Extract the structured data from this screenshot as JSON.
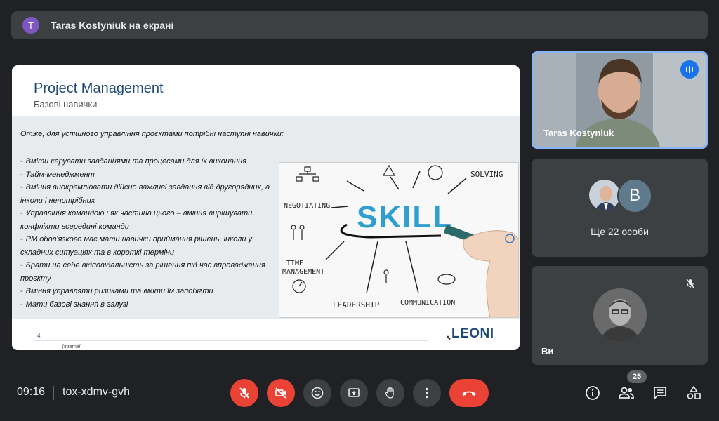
{
  "banner": {
    "avatar_letter": "T",
    "title": "Taras Kostyniuk на екрані"
  },
  "slide": {
    "title": "Project Management",
    "subtitle": "Базові навички",
    "intro": "Отже, для успішного управління проєктами потрібні наступні навички:",
    "bullets": [
      "Вміти керувати завданнями та процесами для їх виконання",
      "Тайм-менеджмент",
      "Вміння виокремлювати дійсно важливі завдання від другорядних, а інколи і непотрібних",
      "Управління командою і як частина цього – вміння вирішувати конфлікти всередині команди",
      "PM обов'язково має мати навички приймання рішень, інколи у складних ситуаціях та в короткі терміни",
      "Брати на себе відповідальність за рішення під час впровадження проєкту",
      "Вміння управляти ризиками та вміти їм запобігти",
      "Мати базові знання в галузі"
    ],
    "image_words": {
      "skill": "SKILL",
      "negotiating": "NEGOTIATING",
      "solving": "SOLVING",
      "time": "TIME",
      "management": "MANAGEMENT",
      "leadership": "LEADERSHIP",
      "communication": "COMMUNICATION"
    },
    "page_number": "4",
    "classification": "[Internal]",
    "logo": "LEONI"
  },
  "tiles": {
    "presenter_name": "Taras Kostyniuk",
    "more_avatar_letter": "B",
    "more_label": "Ще 22 особи",
    "self_label": "Ви"
  },
  "bottom": {
    "time": "09:16",
    "meeting_code": "tox-xdmv-gvh",
    "participants_count": "25"
  },
  "colors": {
    "background": "#202124",
    "surface": "#3c4043",
    "danger": "#ea4335",
    "accent": "#8ab4f8",
    "slide_title": "#1e4a7a"
  },
  "icons": [
    "mic-off-icon",
    "camera-off-icon",
    "emoji-icon",
    "present-icon",
    "hand-icon",
    "more-vert-icon",
    "call-end-icon",
    "info-icon",
    "people-icon",
    "chat-icon",
    "activities-icon",
    "speaking-icon"
  ]
}
